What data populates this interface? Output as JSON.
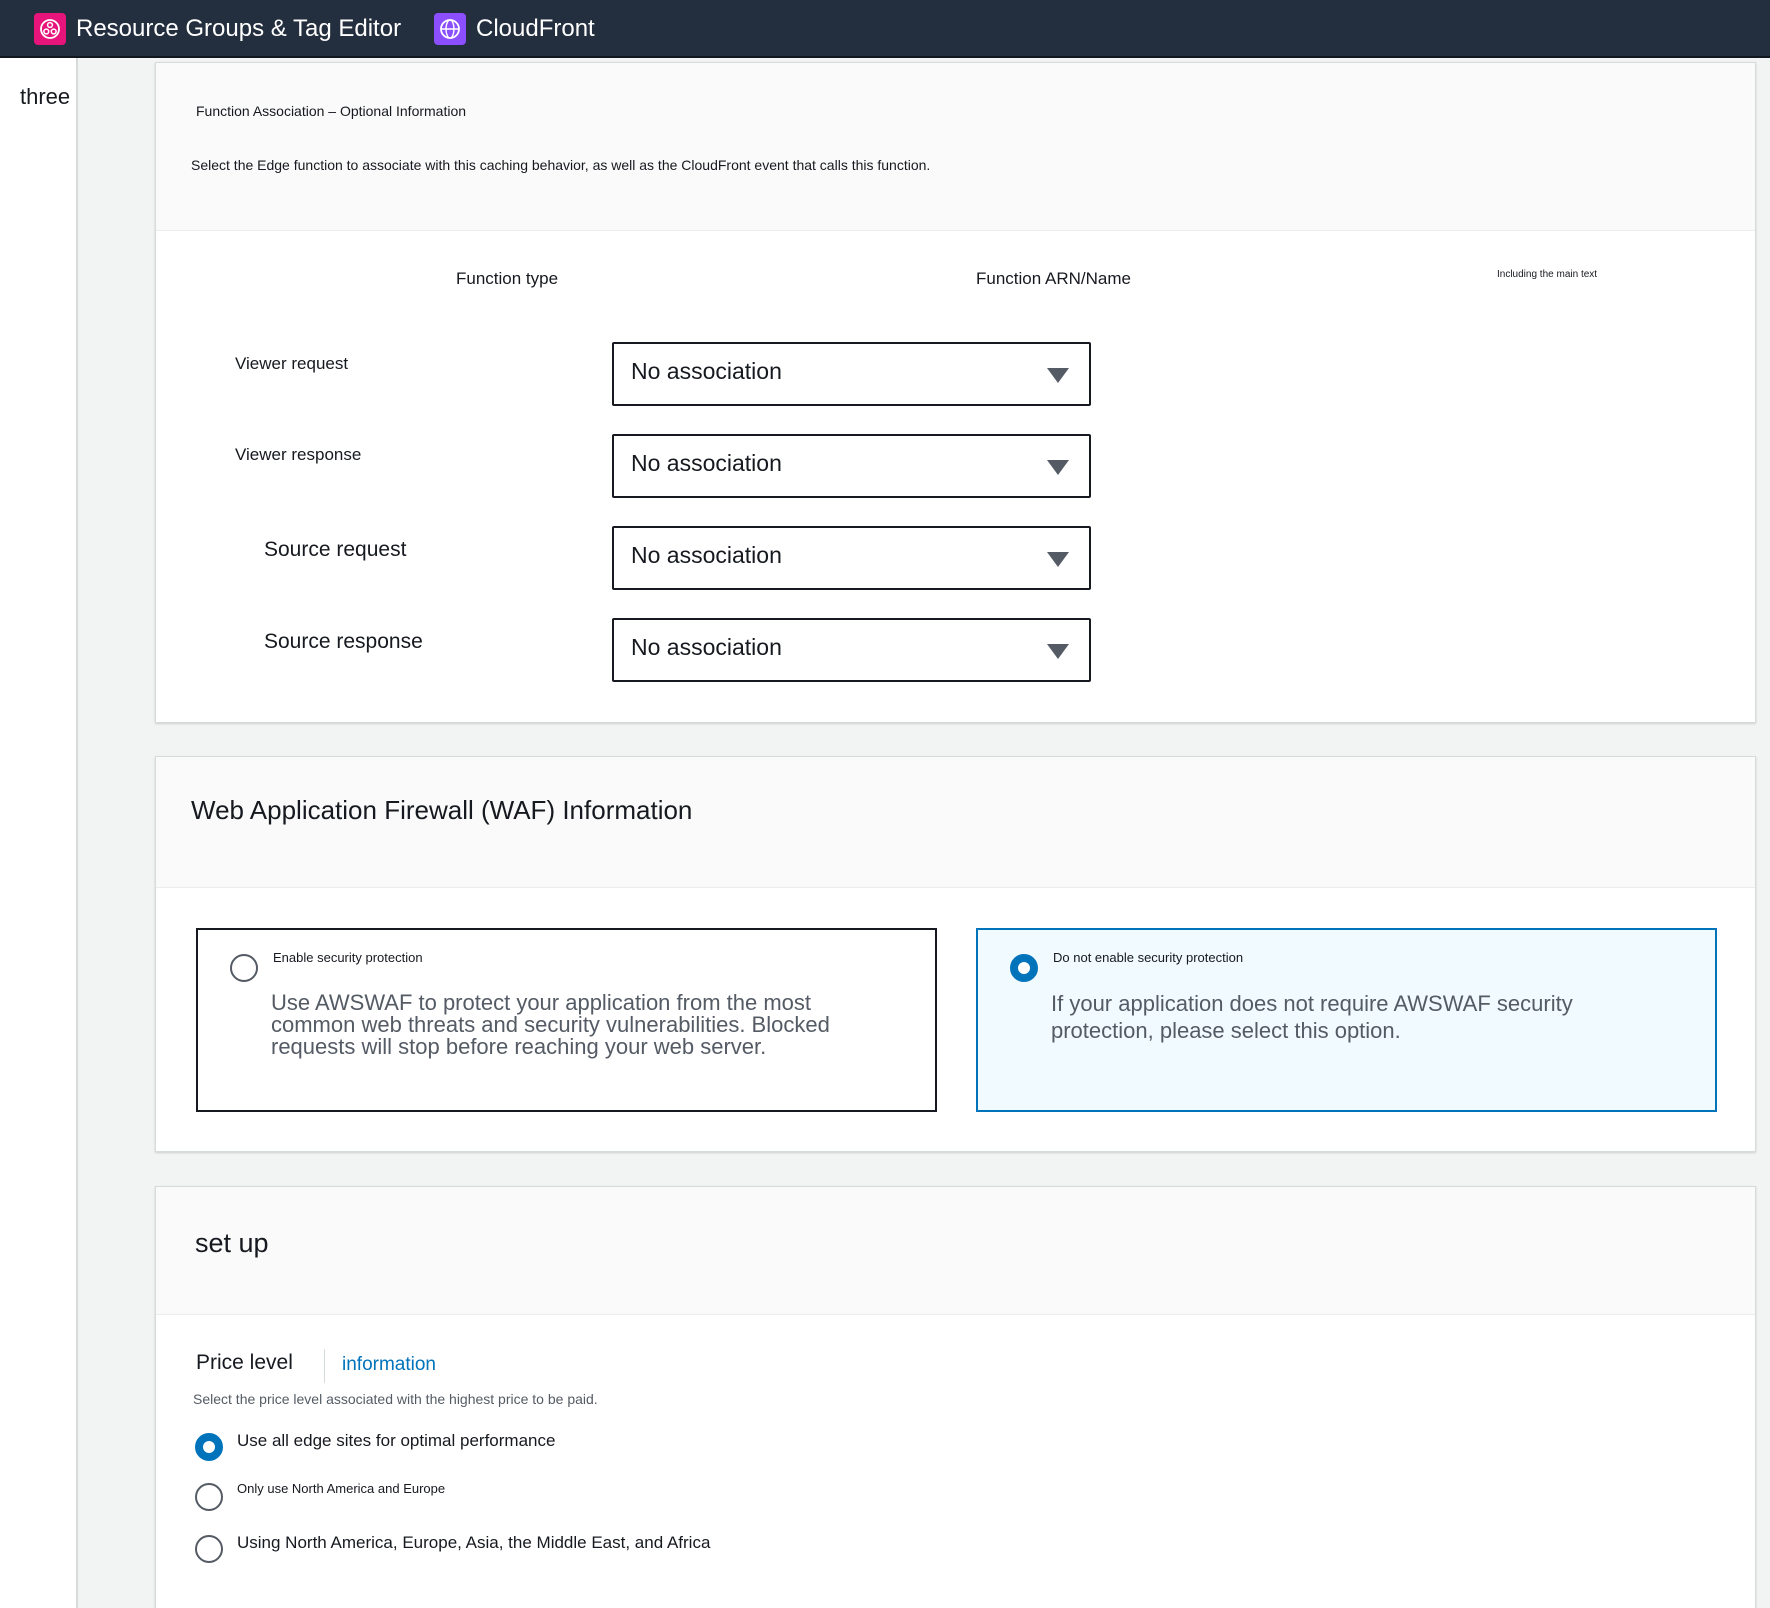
{
  "topbar": {
    "services": [
      {
        "label": "Resource Groups & Tag Editor",
        "icon": "resource-groups-icon",
        "color": "#e7157b"
      },
      {
        "label": "CloudFront",
        "icon": "cloudfront-icon",
        "color": "#8c4fff"
      }
    ]
  },
  "sidebar": {
    "label": "three"
  },
  "function_association": {
    "title": "Function Association – Optional Information",
    "description": "Select the Edge function to associate with this caching behavior, as well as the CloudFront event that calls this function.",
    "columns": {
      "function_type": "Function type",
      "function_arn": "Function ARN/Name",
      "include_body": "Including the main text"
    },
    "rows": [
      {
        "label": "Viewer request",
        "value": "No association"
      },
      {
        "label": "Viewer response",
        "value": "No association"
      },
      {
        "label": "Source request",
        "value": "No association"
      },
      {
        "label": "Source response",
        "value": "No association"
      }
    ]
  },
  "waf": {
    "title": "Web Application Firewall (WAF) Information",
    "options": [
      {
        "title": "Enable security protection",
        "description": "Use AWSWAF to protect your application from the most common web threats and security vulnerabilities. Blocked requests will stop before reaching your web server.",
        "selected": false
      },
      {
        "title": "Do not enable security protection",
        "description": "If your application does not require AWSWAF security protection, please select this option.",
        "selected": true
      }
    ]
  },
  "settings": {
    "title": "set up",
    "price_level": {
      "label": "Price level",
      "info_link": "information",
      "description": "Select the price level associated with the highest price to be paid.",
      "options": [
        {
          "label": "Use all edge sites for optimal performance",
          "selected": true
        },
        {
          "label": "Only use North America and Europe",
          "selected": false
        },
        {
          "label": "Using North America, Europe, Asia, the Middle East, and Africa",
          "selected": false
        }
      ]
    }
  },
  "colors": {
    "accent": "#0073bb",
    "topbar": "#232f3e"
  }
}
